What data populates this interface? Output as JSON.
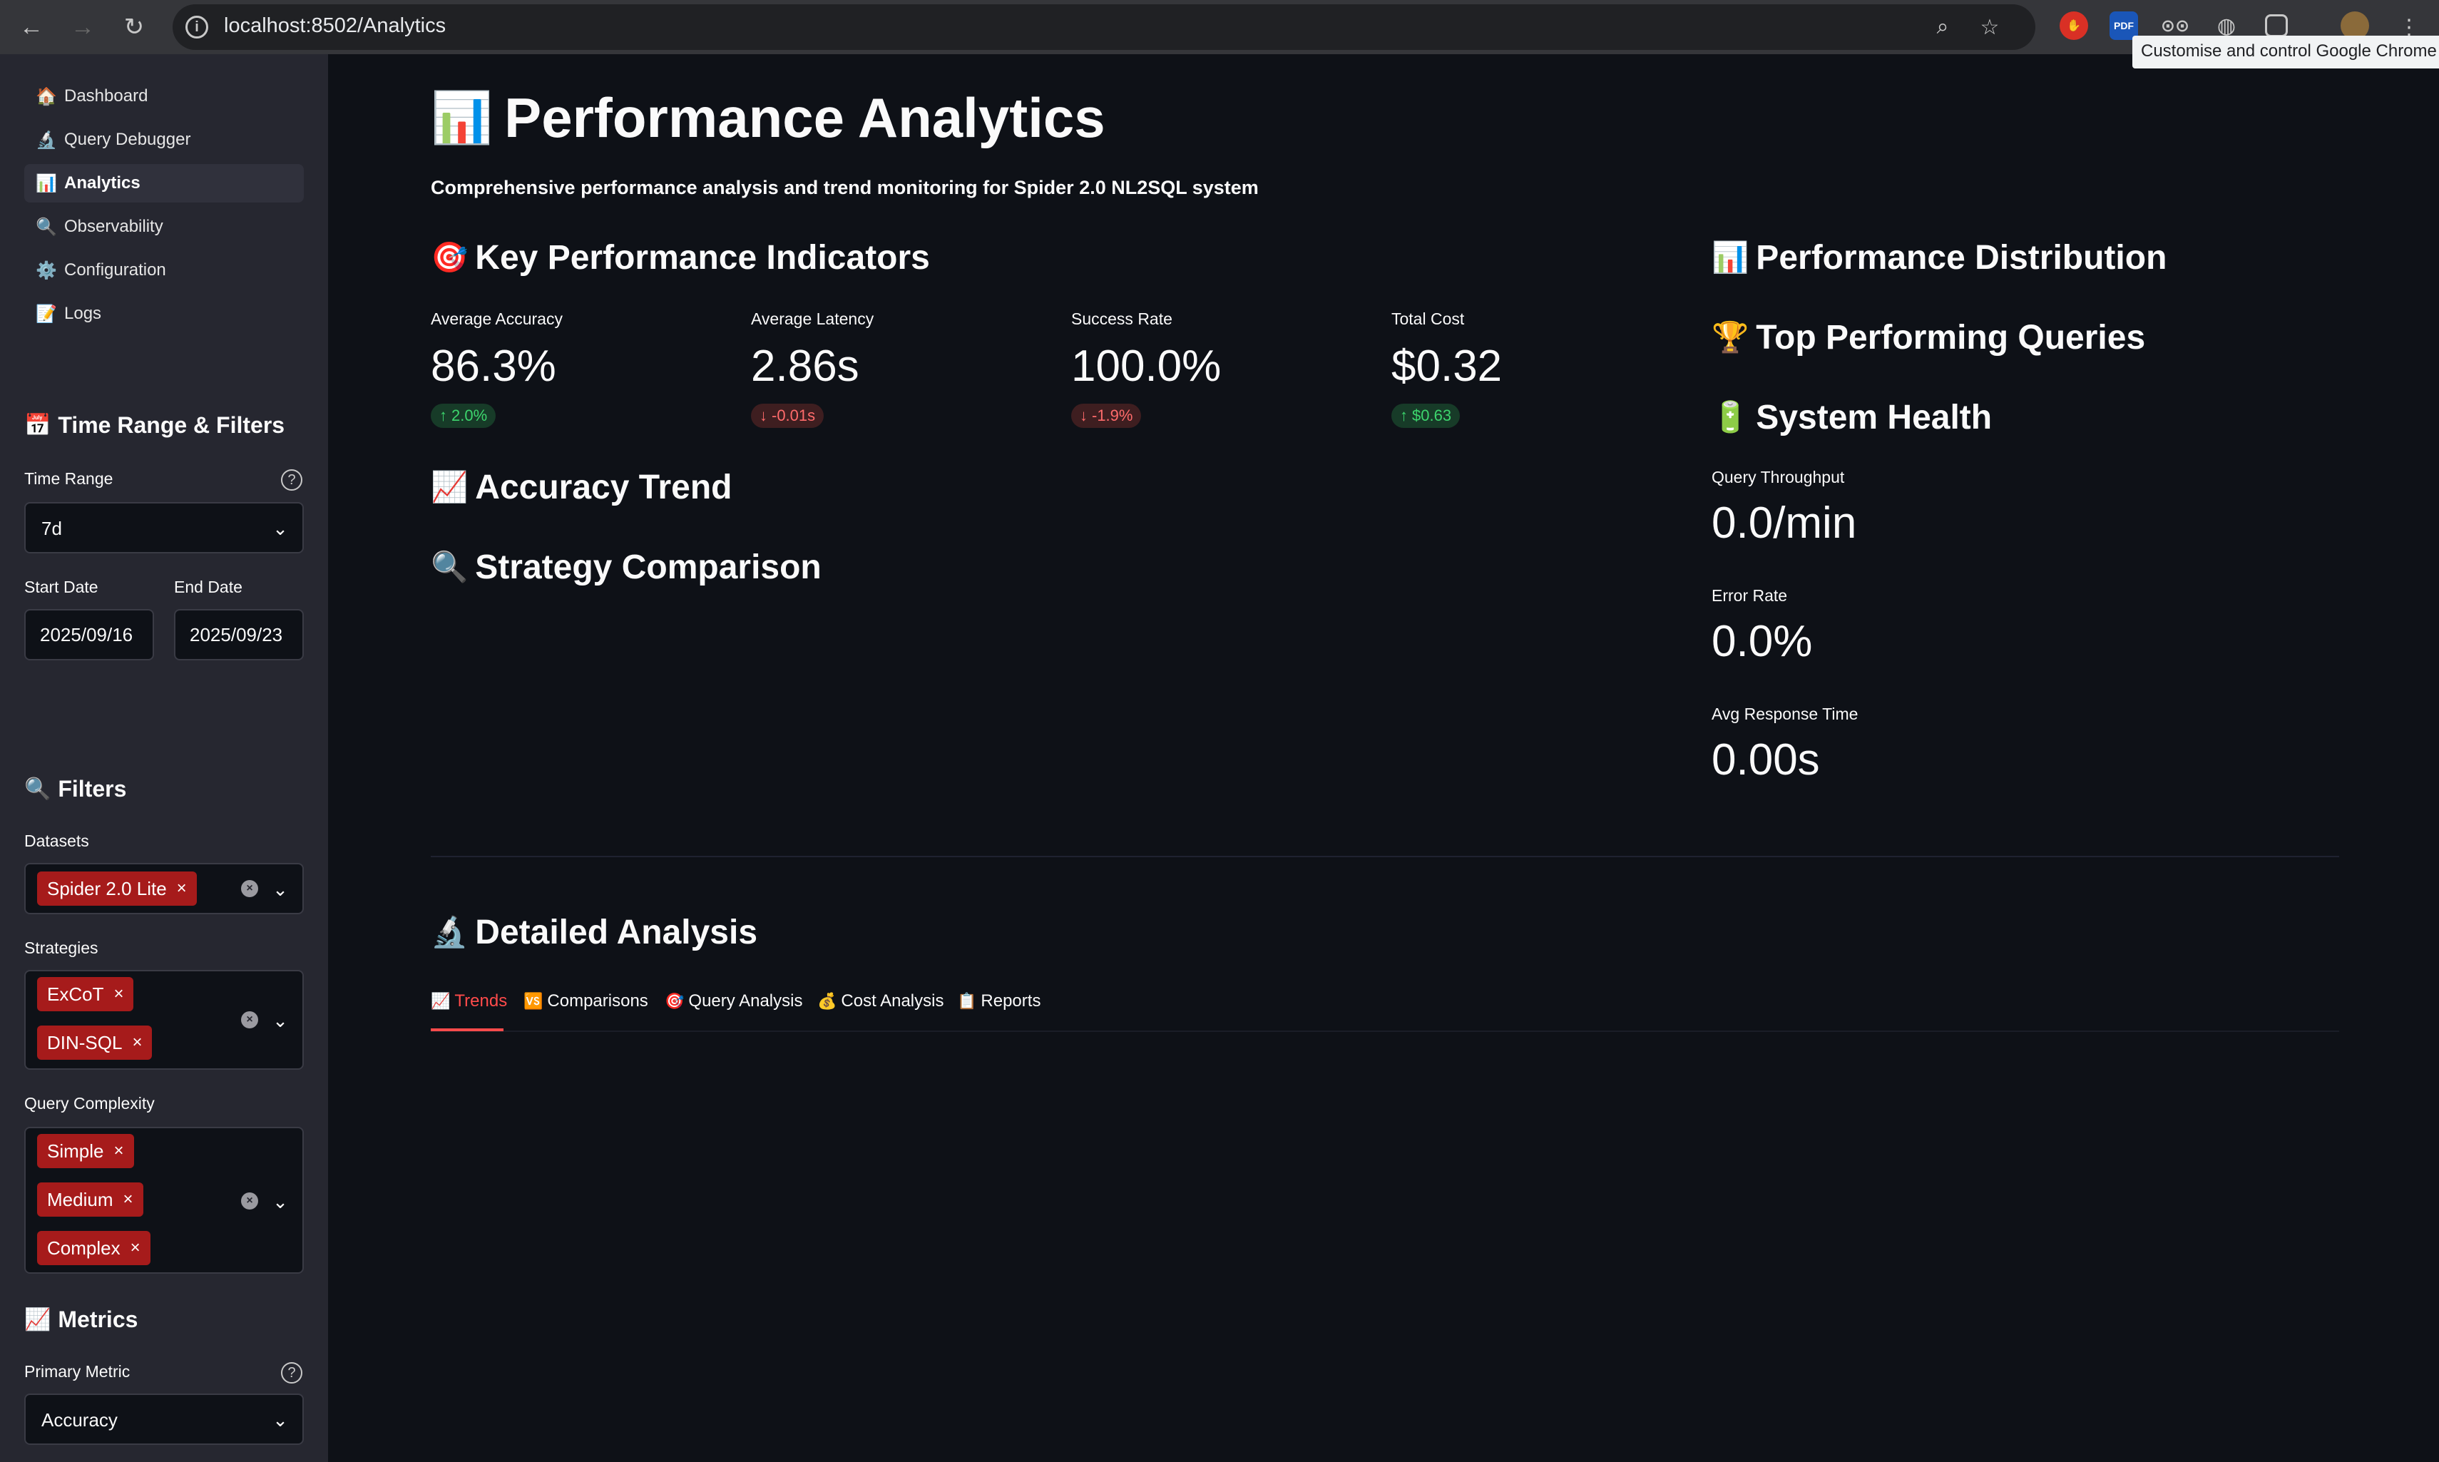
{
  "browser": {
    "url": "localhost:8502/Analytics",
    "tooltip": "Customise and control Google Chrome",
    "extensions": [
      "hand-extension-icon",
      "pdf-extension-icon",
      "glasses-extension-icon",
      "globe-extension-icon",
      "puzzle-extensions-icon",
      "profile-avatar"
    ],
    "pdf_badge": "PDF"
  },
  "sidebar": {
    "nav": [
      {
        "emoji": "🏠",
        "label": "Dashboard"
      },
      {
        "emoji": "🔬",
        "label": "Query Debugger"
      },
      {
        "emoji": "📊",
        "label": "Analytics",
        "active": true
      },
      {
        "emoji": "🔍",
        "label": "Observability"
      },
      {
        "emoji": "⚙️",
        "label": "Configuration"
      },
      {
        "emoji": "📝",
        "label": "Logs"
      }
    ],
    "time_section": {
      "emoji": "📅",
      "title": "Time Range & Filters",
      "time_range_label": "Time Range",
      "time_range_value": "7d",
      "start_date_label": "Start Date",
      "start_date_value": "2025/09/16",
      "end_date_label": "End Date",
      "end_date_value": "2025/09/23"
    },
    "filters_section": {
      "emoji": "🔍",
      "title": "Filters",
      "datasets_label": "Datasets",
      "datasets": [
        "Spider 2.0 Lite"
      ],
      "strategies_label": "Strategies",
      "strategies": [
        "ExCoT",
        "DIN-SQL"
      ],
      "complexity_label": "Query Complexity",
      "complexity": [
        "Simple",
        "Medium",
        "Complex"
      ]
    },
    "metrics_section": {
      "emoji": "📈",
      "title": "Metrics",
      "primary_metric_label": "Primary Metric",
      "primary_metric_value": "Accuracy"
    }
  },
  "main": {
    "title_emoji": "📊",
    "title": "Performance Analytics",
    "subtitle": "Comprehensive performance analysis and trend monitoring for Spider 2.0 NL2SQL system",
    "kpi_heading": {
      "emoji": "🎯",
      "text": "Key Performance Indicators"
    },
    "kpis": [
      {
        "label": "Average Accuracy",
        "value": "86.3%",
        "delta": "2.0%",
        "direction": "up"
      },
      {
        "label": "Average Latency",
        "value": "2.86s",
        "delta": "-0.01s",
        "direction": "down"
      },
      {
        "label": "Success Rate",
        "value": "100.0%",
        "delta": "-1.9%",
        "direction": "down"
      },
      {
        "label": "Total Cost",
        "value": "$0.32",
        "delta": "$0.63",
        "direction": "up"
      }
    ],
    "accuracy_trend_heading": {
      "emoji": "📈",
      "text": "Accuracy Trend"
    },
    "strategy_heading": {
      "emoji": "🔍",
      "text": "Strategy Comparison"
    },
    "distribution_heading": {
      "emoji": "📊",
      "text": "Performance Distribution"
    },
    "top_queries_heading": {
      "emoji": "🏆",
      "text": "Top Performing Queries"
    },
    "health_heading": {
      "emoji": "🔋",
      "text": "System Health"
    },
    "health": [
      {
        "label": "Query Throughput",
        "value": "0.0/min"
      },
      {
        "label": "Error Rate",
        "value": "0.0%"
      },
      {
        "label": "Avg Response Time",
        "value": "0.00s"
      }
    ],
    "detailed_heading": {
      "emoji": "🔬",
      "text": "Detailed Analysis"
    },
    "tabs": [
      {
        "emoji": "📈",
        "label": "Trends",
        "active": true
      },
      {
        "emoji": "🆚",
        "label": "Comparisons"
      },
      {
        "emoji": "🎯",
        "label": "Query Analysis"
      },
      {
        "emoji": "💰",
        "label": "Cost Analysis"
      },
      {
        "emoji": "📋",
        "label": "Reports"
      }
    ]
  },
  "colors": {
    "accent": "#ff4b4b",
    "tag_bg": "#a61b1b",
    "delta_up": "#3dd56d",
    "delta_down": "#ff6b6b",
    "sidebar_bg": "#262730",
    "main_bg": "#0e1117"
  }
}
